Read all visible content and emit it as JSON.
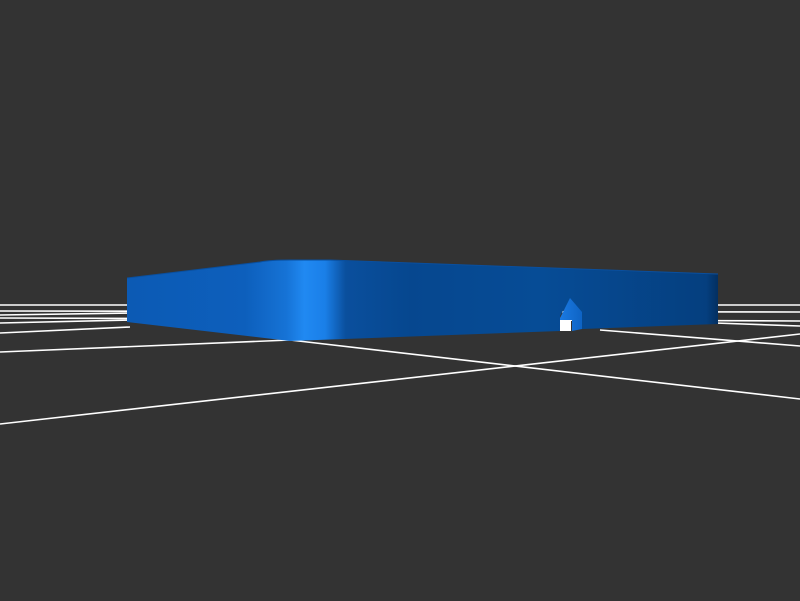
{
  "viewport": {
    "background_color": "#333333",
    "grid_color": "#ffffff",
    "grid_visible": true
  },
  "model": {
    "shape": "rounded-rectangular-plate",
    "color": "#0b5cb6",
    "highlight_color": "#1f86f0",
    "shadow_color": "#033a74",
    "features": [
      "notch"
    ]
  }
}
